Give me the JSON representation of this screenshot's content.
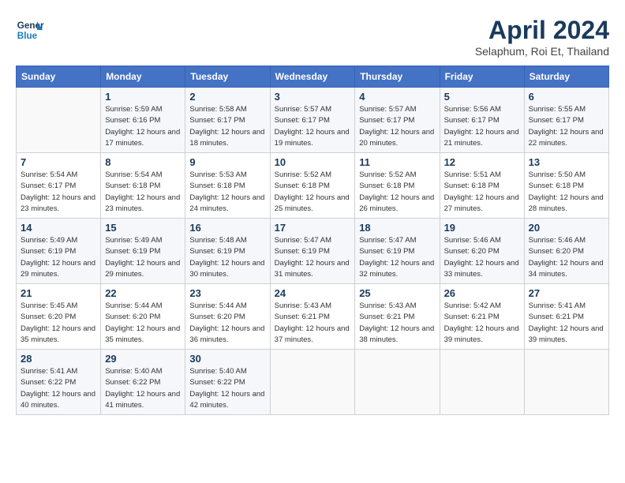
{
  "header": {
    "logo_line1": "General",
    "logo_line2": "Blue",
    "month_title": "April 2024",
    "subtitle": "Selaphum, Roi Et, Thailand"
  },
  "weekdays": [
    "Sunday",
    "Monday",
    "Tuesday",
    "Wednesday",
    "Thursday",
    "Friday",
    "Saturday"
  ],
  "weeks": [
    [
      {
        "day": "",
        "sunrise": "",
        "sunset": "",
        "daylight": ""
      },
      {
        "day": "1",
        "sunrise": "Sunrise: 5:59 AM",
        "sunset": "Sunset: 6:16 PM",
        "daylight": "Daylight: 12 hours and 17 minutes."
      },
      {
        "day": "2",
        "sunrise": "Sunrise: 5:58 AM",
        "sunset": "Sunset: 6:17 PM",
        "daylight": "Daylight: 12 hours and 18 minutes."
      },
      {
        "day": "3",
        "sunrise": "Sunrise: 5:57 AM",
        "sunset": "Sunset: 6:17 PM",
        "daylight": "Daylight: 12 hours and 19 minutes."
      },
      {
        "day": "4",
        "sunrise": "Sunrise: 5:57 AM",
        "sunset": "Sunset: 6:17 PM",
        "daylight": "Daylight: 12 hours and 20 minutes."
      },
      {
        "day": "5",
        "sunrise": "Sunrise: 5:56 AM",
        "sunset": "Sunset: 6:17 PM",
        "daylight": "Daylight: 12 hours and 21 minutes."
      },
      {
        "day": "6",
        "sunrise": "Sunrise: 5:55 AM",
        "sunset": "Sunset: 6:17 PM",
        "daylight": "Daylight: 12 hours and 22 minutes."
      }
    ],
    [
      {
        "day": "7",
        "sunrise": "Sunrise: 5:54 AM",
        "sunset": "Sunset: 6:17 PM",
        "daylight": "Daylight: 12 hours and 23 minutes."
      },
      {
        "day": "8",
        "sunrise": "Sunrise: 5:54 AM",
        "sunset": "Sunset: 6:18 PM",
        "daylight": "Daylight: 12 hours and 23 minutes."
      },
      {
        "day": "9",
        "sunrise": "Sunrise: 5:53 AM",
        "sunset": "Sunset: 6:18 PM",
        "daylight": "Daylight: 12 hours and 24 minutes."
      },
      {
        "day": "10",
        "sunrise": "Sunrise: 5:52 AM",
        "sunset": "Sunset: 6:18 PM",
        "daylight": "Daylight: 12 hours and 25 minutes."
      },
      {
        "day": "11",
        "sunrise": "Sunrise: 5:52 AM",
        "sunset": "Sunset: 6:18 PM",
        "daylight": "Daylight: 12 hours and 26 minutes."
      },
      {
        "day": "12",
        "sunrise": "Sunrise: 5:51 AM",
        "sunset": "Sunset: 6:18 PM",
        "daylight": "Daylight: 12 hours and 27 minutes."
      },
      {
        "day": "13",
        "sunrise": "Sunrise: 5:50 AM",
        "sunset": "Sunset: 6:18 PM",
        "daylight": "Daylight: 12 hours and 28 minutes."
      }
    ],
    [
      {
        "day": "14",
        "sunrise": "Sunrise: 5:49 AM",
        "sunset": "Sunset: 6:19 PM",
        "daylight": "Daylight: 12 hours and 29 minutes."
      },
      {
        "day": "15",
        "sunrise": "Sunrise: 5:49 AM",
        "sunset": "Sunset: 6:19 PM",
        "daylight": "Daylight: 12 hours and 29 minutes."
      },
      {
        "day": "16",
        "sunrise": "Sunrise: 5:48 AM",
        "sunset": "Sunset: 6:19 PM",
        "daylight": "Daylight: 12 hours and 30 minutes."
      },
      {
        "day": "17",
        "sunrise": "Sunrise: 5:47 AM",
        "sunset": "Sunset: 6:19 PM",
        "daylight": "Daylight: 12 hours and 31 minutes."
      },
      {
        "day": "18",
        "sunrise": "Sunrise: 5:47 AM",
        "sunset": "Sunset: 6:19 PM",
        "daylight": "Daylight: 12 hours and 32 minutes."
      },
      {
        "day": "19",
        "sunrise": "Sunrise: 5:46 AM",
        "sunset": "Sunset: 6:20 PM",
        "daylight": "Daylight: 12 hours and 33 minutes."
      },
      {
        "day": "20",
        "sunrise": "Sunrise: 5:46 AM",
        "sunset": "Sunset: 6:20 PM",
        "daylight": "Daylight: 12 hours and 34 minutes."
      }
    ],
    [
      {
        "day": "21",
        "sunrise": "Sunrise: 5:45 AM",
        "sunset": "Sunset: 6:20 PM",
        "daylight": "Daylight: 12 hours and 35 minutes."
      },
      {
        "day": "22",
        "sunrise": "Sunrise: 5:44 AM",
        "sunset": "Sunset: 6:20 PM",
        "daylight": "Daylight: 12 hours and 35 minutes."
      },
      {
        "day": "23",
        "sunrise": "Sunrise: 5:44 AM",
        "sunset": "Sunset: 6:20 PM",
        "daylight": "Daylight: 12 hours and 36 minutes."
      },
      {
        "day": "24",
        "sunrise": "Sunrise: 5:43 AM",
        "sunset": "Sunset: 6:21 PM",
        "daylight": "Daylight: 12 hours and 37 minutes."
      },
      {
        "day": "25",
        "sunrise": "Sunrise: 5:43 AM",
        "sunset": "Sunset: 6:21 PM",
        "daylight": "Daylight: 12 hours and 38 minutes."
      },
      {
        "day": "26",
        "sunrise": "Sunrise: 5:42 AM",
        "sunset": "Sunset: 6:21 PM",
        "daylight": "Daylight: 12 hours and 39 minutes."
      },
      {
        "day": "27",
        "sunrise": "Sunrise: 5:41 AM",
        "sunset": "Sunset: 6:21 PM",
        "daylight": "Daylight: 12 hours and 39 minutes."
      }
    ],
    [
      {
        "day": "28",
        "sunrise": "Sunrise: 5:41 AM",
        "sunset": "Sunset: 6:22 PM",
        "daylight": "Daylight: 12 hours and 40 minutes."
      },
      {
        "day": "29",
        "sunrise": "Sunrise: 5:40 AM",
        "sunset": "Sunset: 6:22 PM",
        "daylight": "Daylight: 12 hours and 41 minutes."
      },
      {
        "day": "30",
        "sunrise": "Sunrise: 5:40 AM",
        "sunset": "Sunset: 6:22 PM",
        "daylight": "Daylight: 12 hours and 42 minutes."
      },
      {
        "day": "",
        "sunrise": "",
        "sunset": "",
        "daylight": ""
      },
      {
        "day": "",
        "sunrise": "",
        "sunset": "",
        "daylight": ""
      },
      {
        "day": "",
        "sunrise": "",
        "sunset": "",
        "daylight": ""
      },
      {
        "day": "",
        "sunrise": "",
        "sunset": "",
        "daylight": ""
      }
    ]
  ]
}
